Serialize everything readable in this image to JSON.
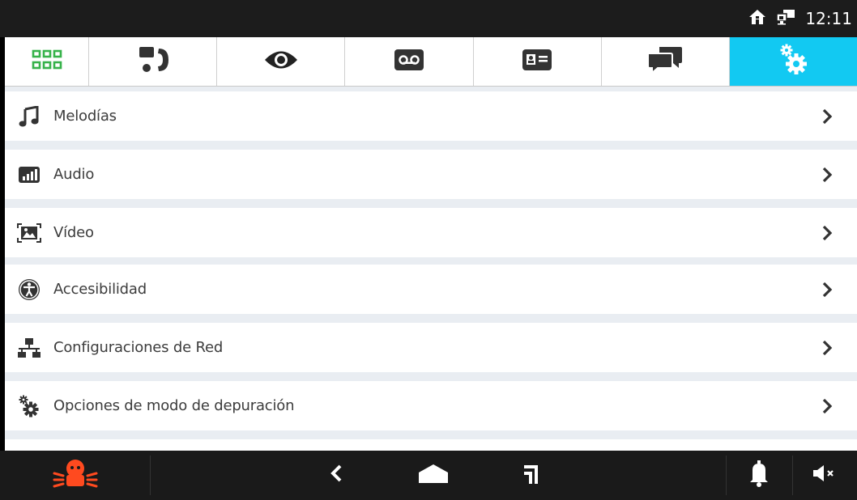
{
  "status_bar": {
    "time": "12:11",
    "icons": [
      "home-icon",
      "network-monitor-icon"
    ]
  },
  "tabs": [
    {
      "icon": "apps-grid-icon",
      "active": false
    },
    {
      "icon": "intercom-handset-icon",
      "active": false
    },
    {
      "icon": "eye-icon",
      "active": false
    },
    {
      "icon": "voicemail-icon",
      "active": false
    },
    {
      "icon": "contact-card-icon",
      "active": false
    },
    {
      "icon": "chat-bubbles-icon",
      "active": false
    },
    {
      "icon": "settings-gears-icon",
      "active": true
    }
  ],
  "settings": {
    "items": [
      {
        "label": "Melodías",
        "icon": "music-note-icon"
      },
      {
        "label": "Audio",
        "icon": "audio-level-icon"
      },
      {
        "label": "Vídeo",
        "icon": "video-image-icon"
      },
      {
        "label": "Accesibilidad",
        "icon": "accessibility-icon"
      },
      {
        "label": "Configuraciones de Red",
        "icon": "network-icon"
      },
      {
        "label": "Opciones de modo de depuración",
        "icon": "debug-gears-icon"
      }
    ]
  },
  "bottom_bar": {
    "icons": [
      "alarm-burglar-icon",
      "back-icon",
      "home-nav-icon",
      "recent-apps-icon",
      "bell-icon",
      "speaker-muted-icon"
    ]
  },
  "colors": {
    "accent": "#12c9f2",
    "grid_green": "#36b24a",
    "alarm_orange": "#ff4a1f",
    "dark_icon": "#333333"
  }
}
